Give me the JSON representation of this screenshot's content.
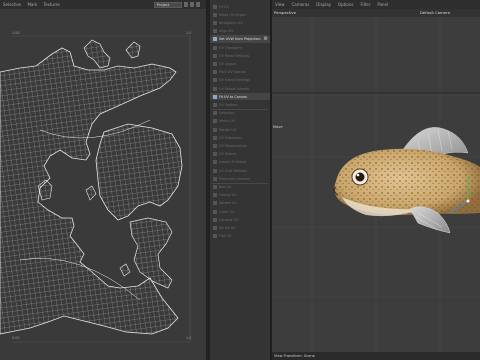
{
  "uv_editor": {
    "menu": [
      "Selection",
      "Mark",
      "Textures"
    ],
    "dropdown_value": "Project",
    "tick_top_left": "1.00",
    "tick_top_right": "1.0",
    "tick_bottom_left": "0.00",
    "tick_bottom_right": "1.0"
  },
  "tools_panel": {
    "items": [
      {
        "label": "Fit UV",
        "active": false
      },
      {
        "label": "Relax UV Edges",
        "active": false
      },
      {
        "label": "Straighten UV",
        "active": false
      },
      {
        "label": "Align UV",
        "active": false
      },
      {
        "label": "Set UVW from Projection",
        "active": true,
        "gear": true
      },
      {
        "label": "UV Transform",
        "active": false
      },
      {
        "label": "UV Relax Settings",
        "active": false
      },
      {
        "label": "UV Layout",
        "active": false
      },
      {
        "label": "Pack UV Islands",
        "active": false
      },
      {
        "label": "UV Island Settings",
        "active": false
      },
      {
        "label": "UV Rotate Islands",
        "active": false
      },
      {
        "label": "Fit UV to Canvas",
        "active": true
      },
      {
        "label": "UV Options",
        "active": false
      },
      {
        "label": "Selection",
        "active": false
      },
      {
        "label": "Mirror UV",
        "active": false
      },
      {
        "label": "Rotate UV",
        "active": false
      },
      {
        "label": "UV Projection",
        "active": false
      },
      {
        "label": "UV Manipulation",
        "active": false
      },
      {
        "label": "UV Seams",
        "active": false
      },
      {
        "label": "Island UV Select",
        "active": false
      },
      {
        "label": "UV Grid Settings",
        "active": false
      },
      {
        "label": "Projection Options",
        "active": false
      },
      {
        "label": "Box UV",
        "active": false
      },
      {
        "label": "Frontal UV",
        "active": false
      },
      {
        "label": "Sphere UV",
        "active": false
      },
      {
        "label": "Cubic UV",
        "active": false
      },
      {
        "label": "Camera UV",
        "active": false
      },
      {
        "label": "Shrink UV",
        "active": false
      },
      {
        "label": "Flat UV",
        "active": false
      }
    ]
  },
  "viewport": {
    "menu": [
      "View",
      "Cameras",
      "Display",
      "Options",
      "Filter",
      "Panel"
    ],
    "view_label": "Perspective",
    "camera_label": "Default Camera",
    "side_label": "Move",
    "status_text": "View Transform: Scene"
  },
  "colors": {
    "uv_wire": "#d8d8d8",
    "uv_bg": "#3a3a3a",
    "fish_body": "#c9a66b",
    "accent_blue": "#8fa9c9"
  }
}
